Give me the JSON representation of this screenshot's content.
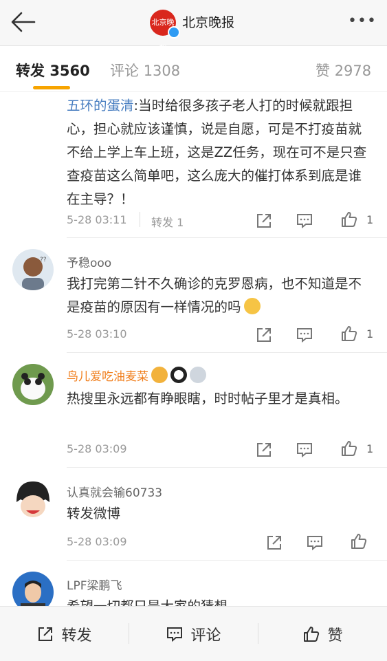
{
  "header": {
    "title": "北京晚报",
    "logo_text": "北京晚報",
    "more": "•••"
  },
  "tabs": {
    "repost_label": "转发",
    "repost_count": "3560",
    "comment_label": "评论",
    "comment_count": "1308",
    "like_label": "赞",
    "like_count": "2978"
  },
  "comments": [
    {
      "username": "五环的蛋清",
      "text": ":当时给很多孩子老人打的时候就跟担心，担心就应该谨慎，说是自愿，可是不打疫苗就不给上学上车上班，这是ZZ任务，现在可不是只查查疫苗这么简单吧，这么庞大的催打体系到底是谁在主导？！",
      "time": "5-28 03:11",
      "repost": "转发 1",
      "likes": "1"
    },
    {
      "username": "予稳ooo",
      "text": "我打完第二针不久确诊的克罗恩病，也不知道是不是疫苗的原因有一样情况的吗",
      "time": "5-28 03:10",
      "likes": "1"
    },
    {
      "username": "鸟儿爱吃油麦菜",
      "text": "热搜里永远都有睁眼瞎，时时帖子里才是真相。",
      "time": "5-28 03:09",
      "likes": "1"
    },
    {
      "username": "认真就会输60733",
      "text": "转发微博",
      "time": "5-28 03:09"
    },
    {
      "username": "LPF梁鹏飞",
      "text": "希望一切都只是大家的猜想"
    }
  ],
  "bottom": {
    "repost": "转发",
    "comment": "评论",
    "like": "赞"
  },
  "colors": {
    "accent": "#f7a400",
    "link": "#4a7fc1",
    "vip_name": "#f07d1a"
  }
}
